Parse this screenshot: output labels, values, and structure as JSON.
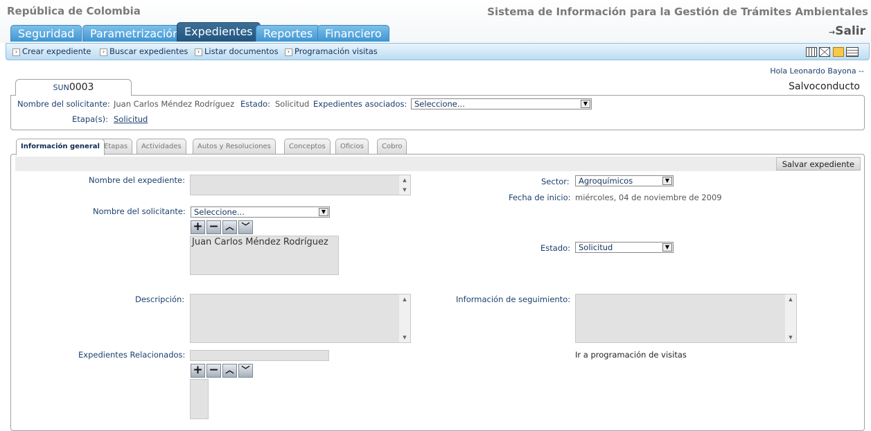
{
  "header": {
    "brand_left": "República de Colombia",
    "brand_right": "Sistema de Información para la Gestión de Trámites Ambientales",
    "salir": "Salir",
    "tabs": [
      {
        "label": "Seguridad"
      },
      {
        "label": "Parametrización"
      },
      {
        "label": "Expedientes"
      },
      {
        "label": "Reportes"
      },
      {
        "label": "Financiero"
      }
    ]
  },
  "menu": {
    "items": [
      {
        "label": "Crear expediente"
      },
      {
        "label": "Buscar expedientes"
      },
      {
        "label": "Listar documentos"
      },
      {
        "label": "Programación visitas"
      }
    ]
  },
  "greeting": "Hola Leonardo Bayona --",
  "record": {
    "id_prefix": "SUN",
    "id_number": "0003",
    "type": "Salvoconducto",
    "solicitante_label": "Nombre del solicitante:",
    "solicitante_value": "Juan Carlos Méndez Rodríguez",
    "estado_label": "Estado:",
    "estado_value": "Solicitud",
    "asociados_label": "Expedientes asociados:",
    "asociados_value": "Seleccione...",
    "etapas_label": "Etapa(s):",
    "etapas_value": "Solicitud"
  },
  "subtabs": [
    {
      "label": "Información general"
    },
    {
      "label": "Etapas"
    },
    {
      "label": "Actividades"
    },
    {
      "label": "Autos y Resoluciones"
    },
    {
      "label": "Conceptos"
    },
    {
      "label": "Oficios"
    },
    {
      "label": "Cobro"
    }
  ],
  "form": {
    "save_label": "Salvar expediente",
    "nombre_expediente_label": "Nombre del expediente:",
    "nombre_solicitante_label": "Nombre del solicitante:",
    "nombre_solicitante_select": "Seleccione...",
    "solicitantes_list": [
      "Juan Carlos Méndez Rodríguez"
    ],
    "descripcion_label": "Descripción:",
    "relacionados_label": "Expedientes Relacionados:",
    "sector_label": "Sector:",
    "sector_value": "Agroquímicos",
    "fecha_label": "Fecha de inicio:",
    "fecha_value": "miércoles, 04 de noviembre de 2009",
    "estado_label": "Estado:",
    "estado_value": "Solicitud",
    "seguimiento_label": "Información de seguimiento:",
    "visitas_link": "Ir a programación de visitas"
  }
}
